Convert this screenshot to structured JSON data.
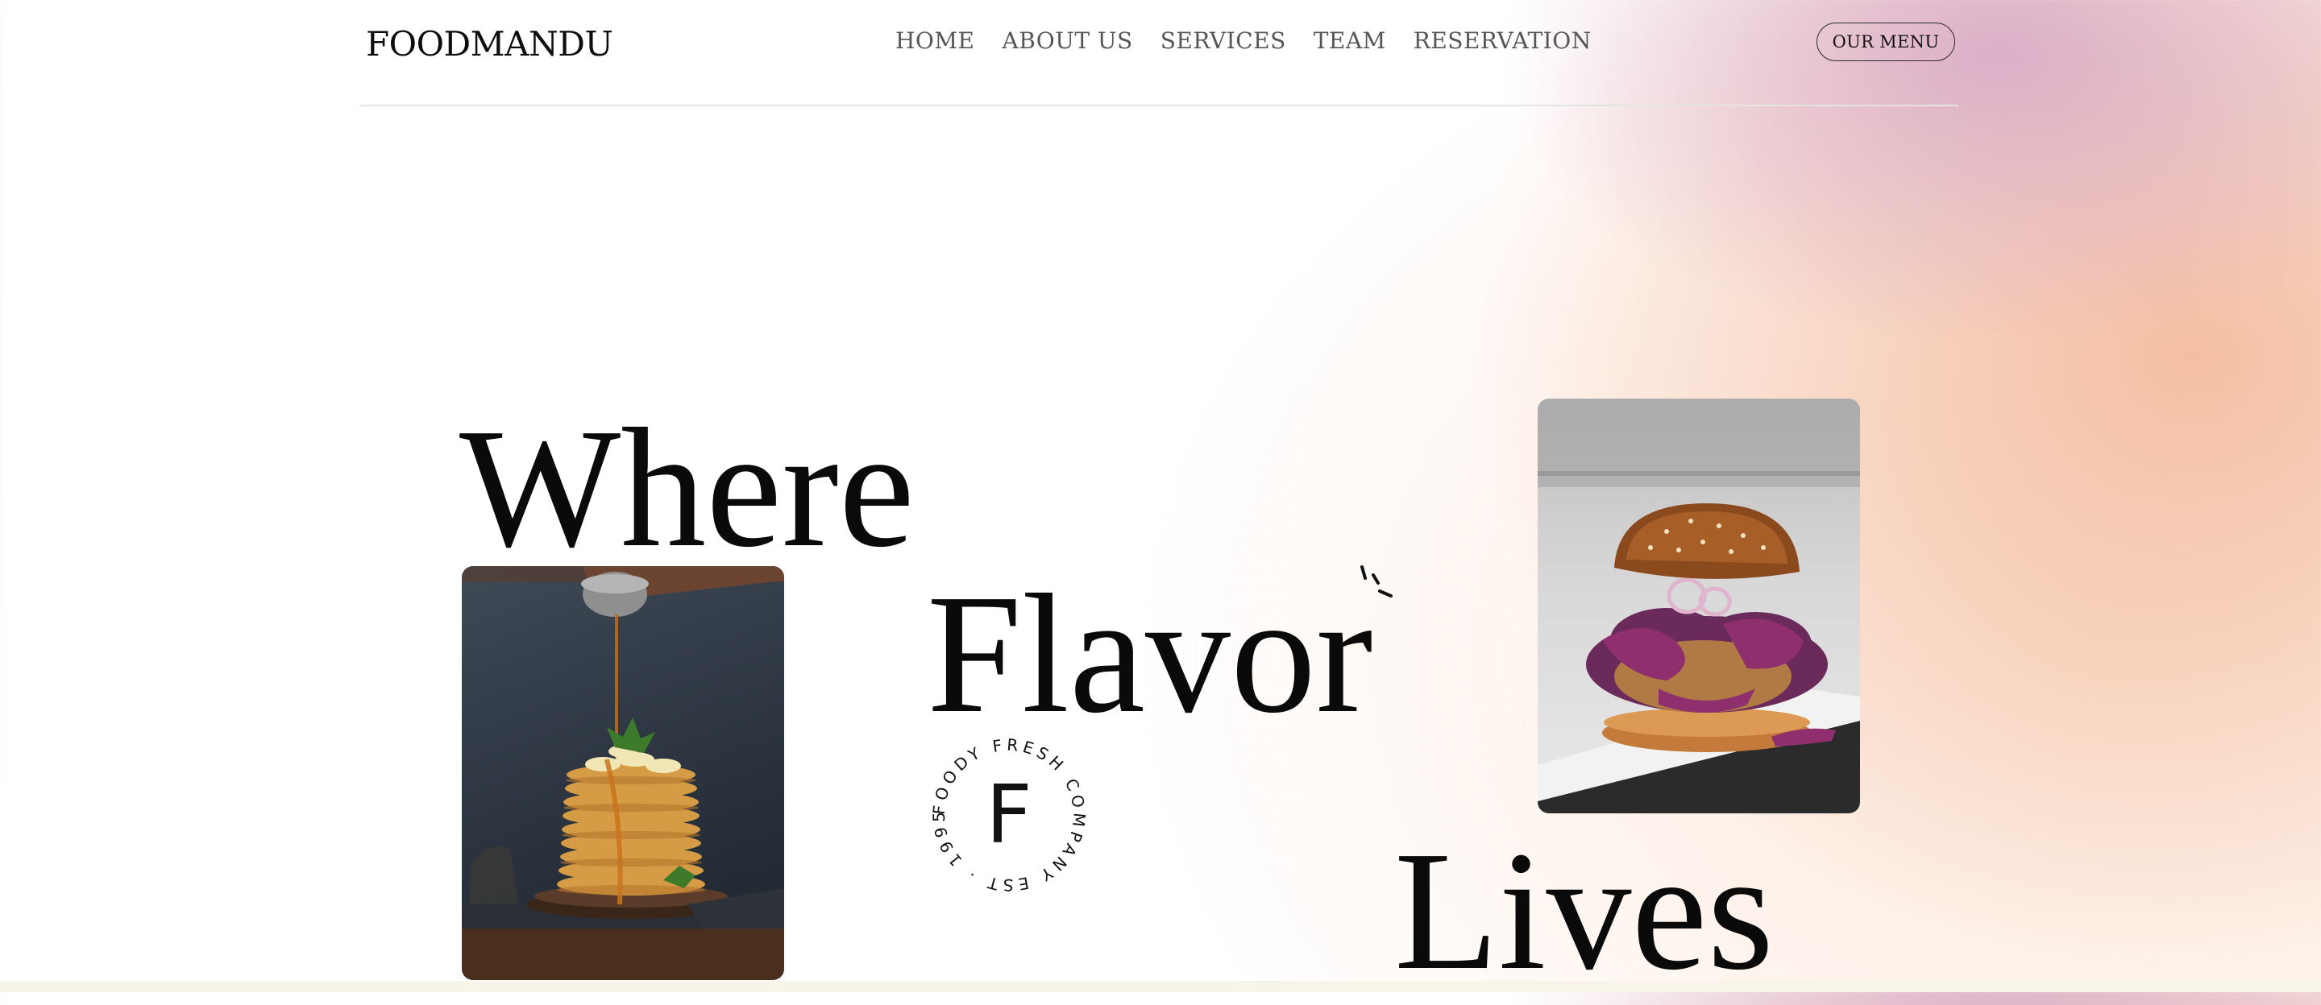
{
  "brand": {
    "name": "FOODMANDU"
  },
  "nav": {
    "items": [
      {
        "label": "HOME"
      },
      {
        "label": "ABOUT US"
      },
      {
        "label": "SERVICES"
      },
      {
        "label": "TEAM"
      },
      {
        "label": "RESERVATION"
      }
    ],
    "cta_label": "OUR MENU"
  },
  "hero": {
    "words": [
      "Where",
      "Flavor",
      "Lives"
    ],
    "badge": {
      "letter": "F",
      "ring_text": "FOODY FRESH COMPANY EST · 1995 ·"
    }
  },
  "images": {
    "pancake": "pancake-stack-photo",
    "burger": "burger-photo"
  },
  "colors": {
    "text": "#0d0d0d",
    "nav_text": "#555555",
    "gradient_pink": "#d6a6c4",
    "gradient_peach": "#f2b596"
  }
}
